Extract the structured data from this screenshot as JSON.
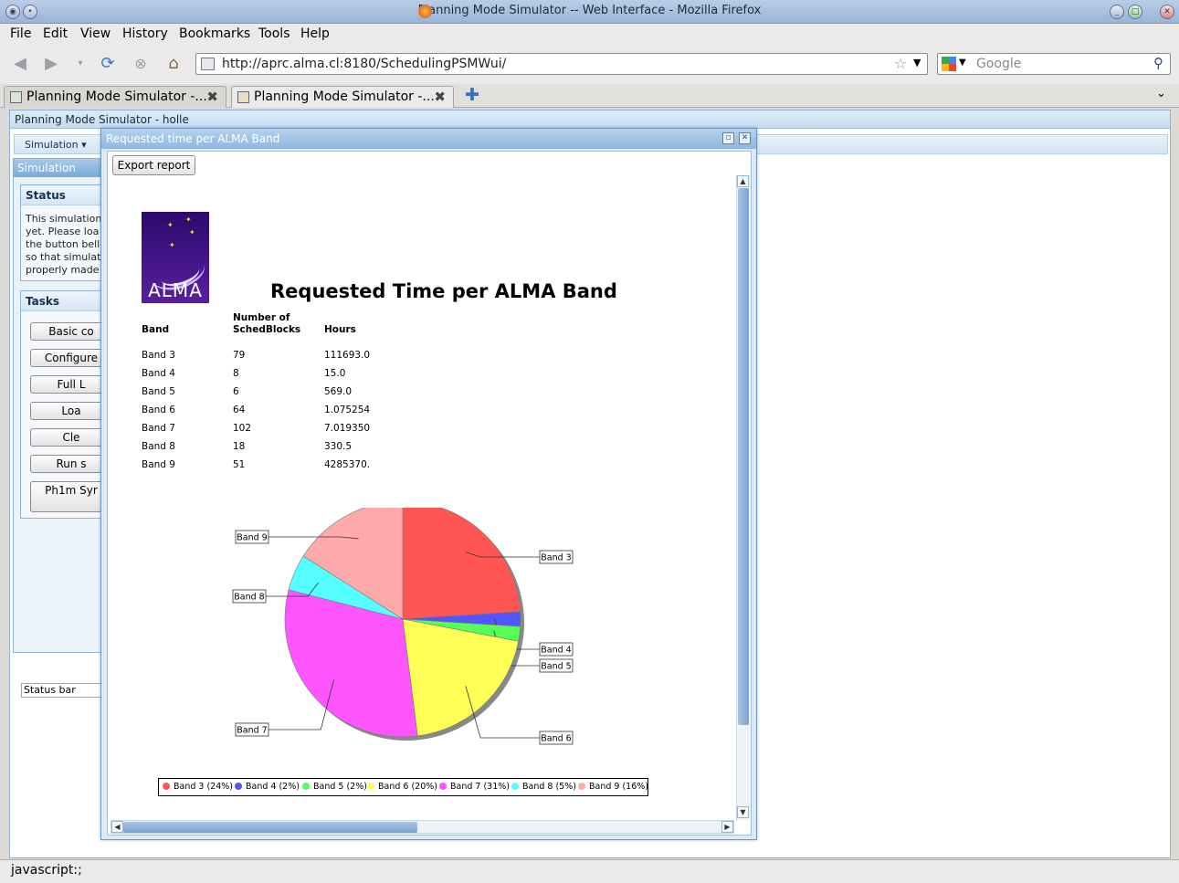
{
  "window": {
    "title": "Planning Mode Simulator -- Web Interface - Mozilla Firefox"
  },
  "menu": {
    "file": "File",
    "edit": "Edit",
    "view": "View",
    "history": "History",
    "bookmarks": "Bookmarks",
    "tools": "Tools",
    "help": "Help"
  },
  "nav": {
    "url": "http://aprc.alma.cl:8180/SchedulingPSMWui/",
    "search_placeholder": "Google"
  },
  "tabs": [
    {
      "label": "Planning Mode Simulator -..."
    },
    {
      "label": "Planning Mode Simulator -..."
    }
  ],
  "app": {
    "header": "Planning Mode Simulator - holle",
    "menu_simulation": "Simulation",
    "sim_panel_title": "Simulation",
    "status_title": "Status",
    "status_lines": [
      "This simulation",
      "yet. Please loa",
      "the button bello",
      "so that simulat",
      "properly made"
    ],
    "tasks_title": "Tasks",
    "task_buttons": [
      "Basic co",
      "Configure",
      "Full L",
      "Loa",
      "Cle",
      "Run s",
      "Ph1m Syr"
    ],
    "status_bar_field": "Status bar"
  },
  "dialog": {
    "title": "Requested time per ALMA Band",
    "export_label": "Export report",
    "report": {
      "logo_text": "ALMA",
      "title": "Requested Time per ALMA Band",
      "columns": [
        "Band",
        "Number of SchedBlocks",
        "Hours"
      ],
      "col_number_line1": "Number of",
      "col_number_line2": "SchedBlocks",
      "rows": [
        {
          "band": "Band 3",
          "sb": "79",
          "hours": "111693.0"
        },
        {
          "band": "Band 4",
          "sb": "8",
          "hours": "15.0"
        },
        {
          "band": "Band 5",
          "sb": "6",
          "hours": "569.0"
        },
        {
          "band": "Band 6",
          "sb": "64",
          "hours": "1.075254"
        },
        {
          "band": "Band 7",
          "sb": "102",
          "hours": "7.019350"
        },
        {
          "band": "Band 8",
          "sb": "18",
          "hours": "330.5"
        },
        {
          "band": "Band 9",
          "sb": "51",
          "hours": "4285370."
        }
      ]
    }
  },
  "chart_data": {
    "type": "pie",
    "title": "",
    "categories": [
      "Band 3",
      "Band 4",
      "Band 5",
      "Band 6",
      "Band 7",
      "Band 8",
      "Band 9"
    ],
    "values": [
      24,
      2,
      2,
      20,
      31,
      5,
      16
    ],
    "colors": [
      "#ff5555",
      "#5555ff",
      "#55ff55",
      "#ffff55",
      "#ff55ff",
      "#55ffff",
      "#ffaaaa"
    ],
    "legend": [
      "Band 3 (24%)",
      "Band 4 (2%)",
      "Band 5 (2%)",
      "Band 6 (20%)",
      "Band 7 (31%)",
      "Band 8 (5%)",
      "Band 9 (16%)"
    ],
    "legend_position": "bottom"
  },
  "statusbar": {
    "text": "javascript:;"
  }
}
